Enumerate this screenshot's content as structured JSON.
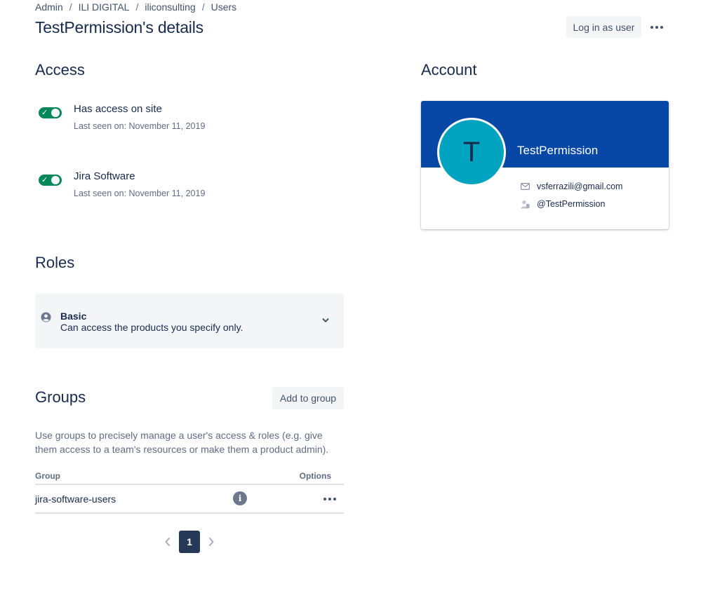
{
  "breadcrumb": {
    "items": [
      "Admin",
      "ILI DIGITAL",
      "iliconsulting",
      "Users"
    ],
    "separator": "/"
  },
  "header": {
    "title": "TestPermission's details",
    "login_button": "Log in as user",
    "more_icon": "more-horizontal-icon"
  },
  "access": {
    "heading": "Access",
    "items": [
      {
        "title": "Has access on site",
        "subtitle": "Last seen on: November 11, 2019",
        "enabled": true
      },
      {
        "title": "Jira Software",
        "subtitle": "Last seen on: November 11, 2019",
        "enabled": true
      }
    ]
  },
  "roles": {
    "heading": "Roles",
    "role": {
      "name": "Basic",
      "description": "Can access the products you specify only."
    }
  },
  "groups": {
    "heading": "Groups",
    "add_button": "Add to group",
    "description": "Use groups to precisely manage a user's access & roles (e.g. give them access to a team's resources or make them a product admin).",
    "columns": [
      "Group",
      "Options"
    ],
    "rows": [
      {
        "name": "jira-software-users"
      }
    ]
  },
  "pagination": {
    "current_page": "1"
  },
  "account": {
    "heading": "Account",
    "avatar_initial": "T",
    "display_name": "TestPermission",
    "email": "vsferrazili@gmail.com",
    "username": "@TestPermission"
  },
  "colors": {
    "toggle_on": "#00875a",
    "card_header": "#0747a6",
    "avatar_bg": "#00a3bf",
    "pager_active": "#253858"
  }
}
